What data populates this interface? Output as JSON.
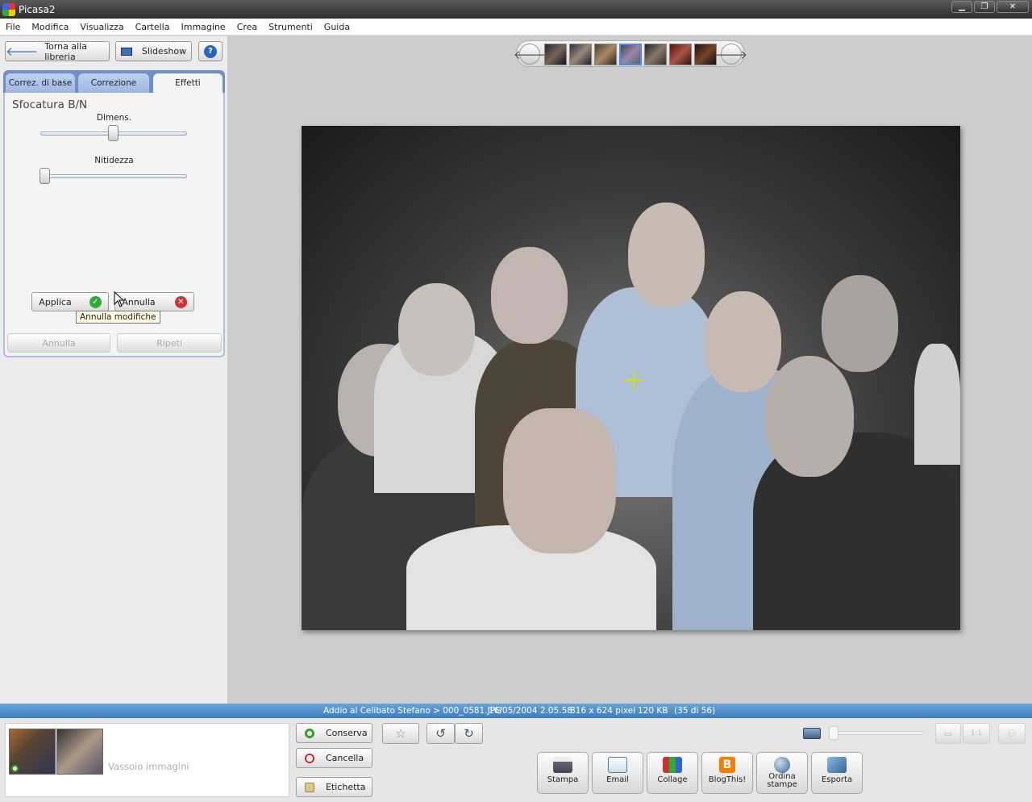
{
  "window": {
    "title": "Picasa2"
  },
  "menu": [
    "File",
    "Modifica",
    "Visualizza",
    "Cartella",
    "Immagine",
    "Crea",
    "Strumenti",
    "Guida"
  ],
  "left": {
    "back_label": "Torna alla libreria",
    "slideshow_label": "Slideshow",
    "help_label": "?",
    "tabs": [
      "Correz. di base",
      "Correzione",
      "Effetti"
    ],
    "effect_title": "Sfocatura B/N",
    "slider1": {
      "label": "Dimens.",
      "value": 0.5
    },
    "slider2": {
      "label": "Nitidezza",
      "value": 0.0
    },
    "apply_label": "Applica",
    "cancel_label": "Annulla",
    "tooltip": "Annulla modifiche",
    "undo_label": "Annulla",
    "redo_label": "Ripeti"
  },
  "status": {
    "path": "Addio al Celibato Stefano > 000_0581.JPG",
    "date": "16/05/2004 2.05.58",
    "dims": "816 x 624 pixel",
    "size": "120 KB",
    "index": "(35 di 56)"
  },
  "bottom": {
    "tray_label": "Vassoio immagini",
    "keep_label": "Conserva",
    "clear_label": "Cancella",
    "tag_label": "Etichetta",
    "actions": [
      "Stampa",
      "Email",
      "Collage",
      "BlogThis!",
      "Ordina stampe",
      "Esporta"
    ]
  },
  "colors": {
    "accent": "#4a8de0",
    "status": "#4d8bc6",
    "tabs": "#6f8fc9"
  }
}
